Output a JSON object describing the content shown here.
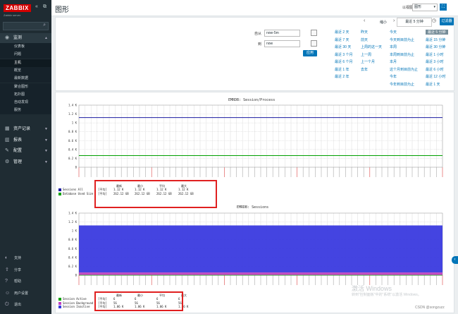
{
  "sidebar": {
    "logo": "ZABBIX",
    "logo_sub": "Zabbix server",
    "collapse": "«",
    "expand": "⧉",
    "monitor": "监测",
    "sub_items": [
      {
        "label": "仪表板"
      },
      {
        "label": "问题"
      },
      {
        "label": "主机"
      },
      {
        "label": "概览"
      },
      {
        "label": "最新数据"
      },
      {
        "label": "聚合图形"
      },
      {
        "label": "拓扑图"
      },
      {
        "label": "自动发现"
      },
      {
        "label": "服务"
      }
    ],
    "sections": [
      {
        "label": "资产记录"
      },
      {
        "label": "报表"
      },
      {
        "label": "配置"
      },
      {
        "label": "管理"
      }
    ],
    "bottom": [
      {
        "label": "支持"
      },
      {
        "label": "分享"
      },
      {
        "label": "帮助"
      },
      {
        "label": "用户设置"
      },
      {
        "label": "退出"
      }
    ]
  },
  "header": {
    "title": "图形",
    "view_as": "以视图",
    "view_value": "图形"
  },
  "filter": {
    "zoom_out": "缩小",
    "tab_time": "最近 5 分钟",
    "tab_filter": "过滤器",
    "from_label": "自从",
    "from_value": "now-5m",
    "to_label": "到",
    "to_value": "now",
    "apply": "应用",
    "quick": [
      [
        "最近 2 天",
        "昨天",
        "今天",
        "最近 5 分钟"
      ],
      [
        "最近 7 天",
        "前天",
        "今天到目前为止",
        "最近 15 分钟"
      ],
      [
        "最近 30 天",
        "上周的这一天",
        "本周",
        "最近 30 分钟"
      ],
      [
        "最近 3 个月",
        "上一周",
        "本周到目前为止",
        "最近 1 小时"
      ],
      [
        "最近 6 个月",
        "上一个月",
        "本月",
        "最近 3 小时"
      ],
      [
        "最近 1 年",
        "去年",
        "这个月到目前为止",
        "最近 6 小时"
      ],
      [
        "最近 2 年",
        "",
        "今年",
        "最近 12 小时"
      ],
      [
        "",
        "",
        "今年到目前为止",
        "最近 1 天"
      ]
    ]
  },
  "graph1": {
    "title": "EMRDB: Session/Process",
    "legend_head": [
      "最新",
      "最小",
      "平均",
      "最大"
    ],
    "series": [
      {
        "name": "Sessions All",
        "color": "#1a1aa0",
        "type": "[平均]",
        "last": "1.12 K",
        "min": "1.12 K",
        "avg": "1.12 K",
        "max": "1.12 K"
      },
      {
        "name": "Database Used Size",
        "color": "#00a000",
        "type": "[平均]",
        "last": "262.12 GB",
        "min": "262.12 GB",
        "avg": "262.12 GB",
        "max": "262.12 GB"
      }
    ]
  },
  "graph2": {
    "title": "EMRDB: Sessions",
    "legend_head": [
      "最新",
      "最小",
      "平均",
      "最大"
    ],
    "series": [
      {
        "name": "Session Active",
        "color": "#00a000",
        "type": "[平均]",
        "last": "6",
        "min": "6",
        "avg": "6",
        "max": "6"
      },
      {
        "name": "Session Background",
        "color": "#c040c0",
        "type": "[平均]",
        "last": "56",
        "min": "56",
        "avg": "56",
        "max": "56"
      },
      {
        "name": "Session Inactive",
        "color": "#3a3adf",
        "type": "[平均]",
        "last": "1.06 K",
        "min": "1.06 K",
        "avg": "1.06 K",
        "max": "1.06 K"
      }
    ]
  },
  "chart_data": [
    {
      "type": "line",
      "title": "EMRDB: Session/Process",
      "y_ticks": [
        "1.4 K",
        "1.2 K",
        "1 K",
        "0.8 K",
        "0.6 K",
        "0.4 K",
        "0.2 K",
        "0"
      ],
      "ylim": [
        0,
        1400
      ],
      "series": [
        {
          "name": "Sessions All",
          "values": [
            1120
          ]
        },
        {
          "name": "Database Used Size",
          "values": [
            262.12
          ]
        }
      ]
    },
    {
      "type": "area",
      "title": "EMRDB: Sessions",
      "y_ticks": [
        "1.4 K",
        "1.2 K",
        "1 K",
        "0.8 K",
        "0.6 K",
        "0.4 K",
        "0.2 K",
        "0"
      ],
      "ylim": [
        0,
        1400
      ],
      "series": [
        {
          "name": "Session Active",
          "values": [
            6
          ]
        },
        {
          "name": "Session Background",
          "values": [
            56
          ]
        },
        {
          "name": "Session Inactive",
          "values": [
            1060
          ]
        }
      ]
    }
  ],
  "watermark": {
    "line1": "激活 Windows",
    "line2": "转到\"控制面板\"中的\"系统\"以激活 Windows。",
    "csdn": "CSDN @songzuzz"
  }
}
